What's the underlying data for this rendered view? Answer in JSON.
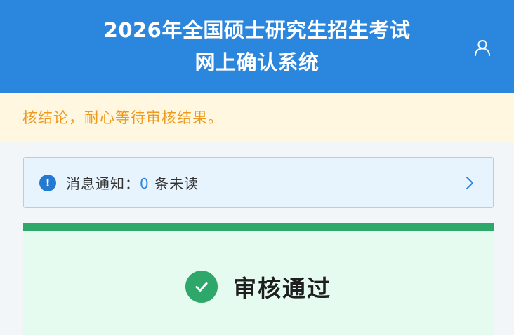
{
  "header": {
    "title_line1": "2026年全国硕士研究生招生考试",
    "title_line2": "网上确认系统",
    "user_icon": "user-icon"
  },
  "marquee": {
    "text": "核结论，耐心等待审核结果。"
  },
  "notice": {
    "icon": "info-icon",
    "label": "消息通知：",
    "count": "0",
    "suffix": "条未读",
    "chevron_icon": "chevron-right-icon"
  },
  "status": {
    "icon": "check-circle-icon",
    "text": "审核通过"
  },
  "colors": {
    "header_bg": "#2b86de",
    "marquee_bg": "#fff7e0",
    "marquee_text": "#ee9a1e",
    "notice_bg": "#e8f4fd",
    "success": "#2ea86a",
    "success_bg": "#e5fbf0"
  }
}
